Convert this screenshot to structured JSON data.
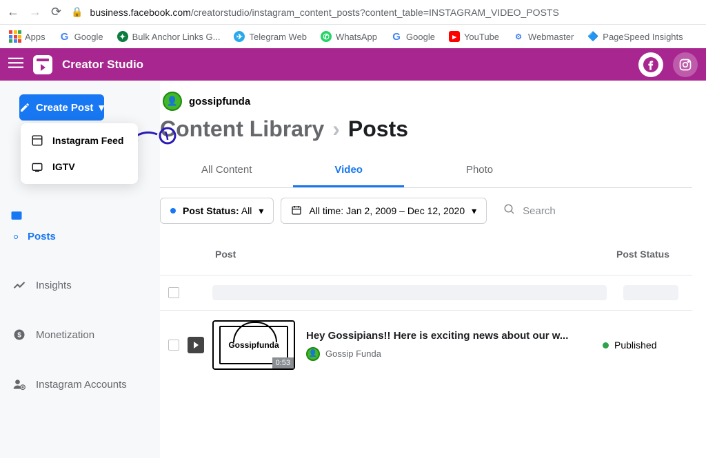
{
  "browser": {
    "url_domain": "business.facebook.com",
    "url_path": "/creatorstudio/instagram_content_posts?content_table=INSTAGRAM_VIDEO_POSTS"
  },
  "bookmarks": [
    {
      "label": "Apps",
      "icon": "apps"
    },
    {
      "label": "Google",
      "icon": "g-multi"
    },
    {
      "label": "Bulk Anchor Links G...",
      "icon": "green-circ"
    },
    {
      "label": "Telegram Web",
      "icon": "blue-circ"
    },
    {
      "label": "WhatsApp",
      "icon": "wa"
    },
    {
      "label": "Google",
      "icon": "g-multi"
    },
    {
      "label": "YouTube",
      "icon": "yt"
    },
    {
      "label": "Webmaster",
      "icon": "wm"
    },
    {
      "label": "PageSpeed Insights",
      "icon": "ps"
    }
  ],
  "header": {
    "title": "Creator Studio"
  },
  "create_btn": {
    "label": "Create Post"
  },
  "dropdown": [
    {
      "label": "Instagram Feed",
      "icon": "feed"
    },
    {
      "label": "IGTV",
      "icon": "tv"
    }
  ],
  "nav": [
    {
      "label": "Content Library",
      "active": false,
      "icon": "lib"
    },
    {
      "label": "Posts",
      "active": true,
      "icon": "dot"
    },
    {
      "label": "Insights",
      "active": false,
      "icon": "insights"
    },
    {
      "label": "Monetization",
      "active": false,
      "icon": "money"
    },
    {
      "label": "Instagram Accounts",
      "active": false,
      "icon": "accounts"
    }
  ],
  "account": {
    "name": "gossipfunda"
  },
  "crumbs": {
    "a": "Content Library",
    "b": "Posts"
  },
  "tabs": [
    {
      "label": "All Content",
      "active": false
    },
    {
      "label": "Video",
      "active": true
    },
    {
      "label": "Photo",
      "active": false
    }
  ],
  "filters": {
    "status_label": "Post Status:",
    "status_value": "All",
    "date_value": "All time: Jan 2, 2009 – Dec 12, 2020",
    "search_placeholder": "Search"
  },
  "table": {
    "head": {
      "post": "Post",
      "status": "Post Status"
    },
    "rows": [
      {
        "skeleton": true
      },
      {
        "thumb_text": "Gossipfunda",
        "duration": "0:53",
        "title": "Hey Gossipians!! Here is exciting news about our w...",
        "author": "Gossip Funda",
        "status": "Published"
      }
    ]
  }
}
